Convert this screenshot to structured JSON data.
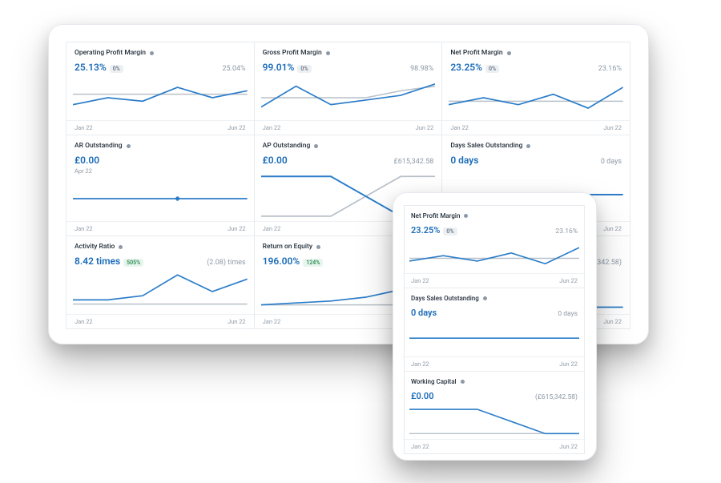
{
  "axis": {
    "start": "Jan 22",
    "end": "Jun 22"
  },
  "chart_data": [
    {
      "id": "opm",
      "title": "Operating Profit Margin",
      "type": "line",
      "metric": "25.13%",
      "badge": "0%",
      "badge_style": "gray",
      "comparison": "25.04%",
      "series": [
        {
          "name": "current",
          "values": [
            22,
            24,
            23,
            27,
            24,
            26
          ]
        },
        {
          "name": "prior",
          "values": [
            25,
            25,
            25,
            25,
            25,
            25
          ]
        }
      ],
      "ylim": [
        18,
        30
      ]
    },
    {
      "id": "gpm",
      "title": "Gross Profit Margin",
      "type": "line",
      "metric": "99.01%",
      "badge": "0%",
      "badge_style": "gray",
      "comparison": "98.98%",
      "series": [
        {
          "name": "current",
          "values": [
            95,
            104,
            96,
            98,
            100,
            105
          ]
        },
        {
          "name": "prior",
          "values": [
            99,
            99,
            99,
            99,
            102,
            104
          ]
        }
      ],
      "ylim": [
        90,
        108
      ]
    },
    {
      "id": "npm",
      "title": "Net Profit Margin",
      "type": "line",
      "metric": "23.25%",
      "badge": "0%",
      "badge_style": "gray",
      "comparison": "23.16%",
      "series": [
        {
          "name": "current",
          "values": [
            22,
            24,
            22,
            25,
            21,
            27
          ]
        },
        {
          "name": "prior",
          "values": [
            23,
            23,
            23,
            23,
            23,
            23
          ]
        }
      ],
      "ylim": [
        18,
        30
      ]
    },
    {
      "id": "ar",
      "title": "AR Outstanding",
      "type": "line",
      "metric": "£0.00",
      "comparison": "",
      "sub": "Apr 22",
      "series": [
        {
          "name": "current",
          "values": [
            0,
            0,
            0,
            0,
            0,
            0
          ]
        }
      ],
      "ylim": [
        -1,
        1
      ],
      "marker": 3
    },
    {
      "id": "ap",
      "title": "AP Outstanding",
      "type": "line",
      "metric": "£0.00",
      "comparison": "£615,342.58",
      "series": [
        {
          "name": "current",
          "values": [
            600,
            600,
            600,
            300,
            0,
            0
          ]
        },
        {
          "name": "prior",
          "values": [
            0,
            0,
            0,
            300,
            600,
            600
          ]
        }
      ],
      "ylim": [
        -50,
        700
      ]
    },
    {
      "id": "dso",
      "title": "Days Sales Outstanding",
      "type": "line",
      "metric": "0 days",
      "comparison": "0 days",
      "series": [
        {
          "name": "current",
          "values": [
            0,
            0,
            0,
            0,
            0,
            0
          ]
        }
      ],
      "ylim": [
        -1,
        1
      ]
    },
    {
      "id": "act",
      "title": "Activity Ratio",
      "type": "line",
      "metric": "8.42 times",
      "badge": "505%",
      "badge_style": "green",
      "comparison": "(2.08) times",
      "series": [
        {
          "name": "current",
          "values": [
            3,
            3,
            4,
            9,
            5,
            8
          ]
        },
        {
          "name": "prior",
          "values": [
            2,
            2,
            2,
            2,
            2,
            2
          ]
        }
      ],
      "ylim": [
        0,
        10
      ]
    },
    {
      "id": "roe",
      "title": "Return on Equity",
      "type": "line",
      "metric": "196.00%",
      "badge": "124%",
      "badge_style": "green",
      "comparison": "",
      "series": [
        {
          "name": "current",
          "values": [
            120,
            125,
            130,
            140,
            160,
            196
          ]
        },
        {
          "name": "prior",
          "values": [
            120,
            120,
            120,
            120,
            120,
            120
          ]
        }
      ],
      "ylim": [
        100,
        210
      ]
    },
    {
      "id": "wc",
      "title": "Working Capital",
      "type": "line",
      "metric": "£0.00",
      "comparison": "(£615,342.58)",
      "series": [
        {
          "name": "current",
          "values": [
            0,
            0,
            0,
            -300,
            -600,
            -600
          ]
        },
        {
          "name": "prior",
          "values": [
            -600,
            -600,
            -600,
            -600,
            -600,
            -600
          ]
        }
      ],
      "ylim": [
        -700,
        100
      ]
    }
  ],
  "desktop_layout": [
    "opm",
    "gpm",
    "npm",
    "ar",
    "ap",
    "dso",
    "act",
    "roe",
    "wc"
  ],
  "tablet_layout": [
    "npm",
    "dso",
    "wc"
  ]
}
